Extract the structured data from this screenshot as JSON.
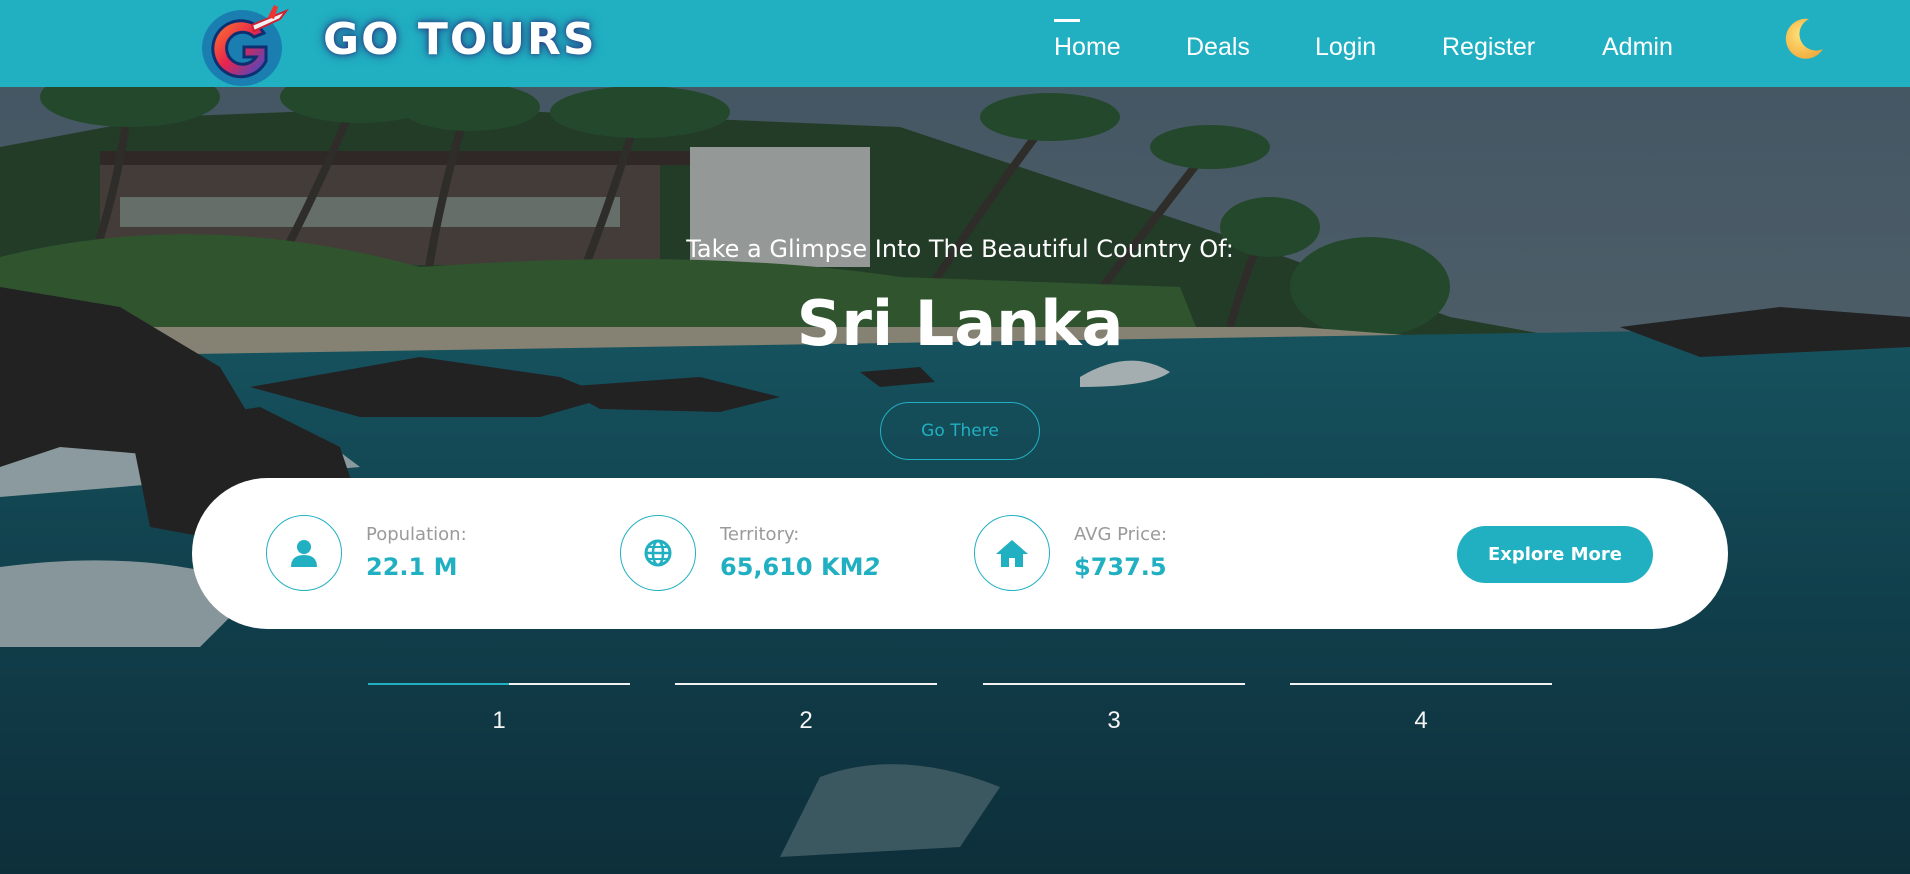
{
  "header": {
    "brand": "GO TOURS",
    "nav": [
      {
        "label": "Home",
        "active": true
      },
      {
        "label": "Deals"
      },
      {
        "label": "Login"
      },
      {
        "label": "Register"
      },
      {
        "label": "Admin"
      }
    ],
    "theme_toggle_icon": "moon-icon",
    "logo_icon": "g-airplane-logo",
    "colors": {
      "accent": "#21b0c2",
      "text_on_accent": "#ffffff"
    }
  },
  "hero": {
    "tagline": "Take a Glimpse Into The Beautiful Country Of:",
    "country": "Sri Lanka",
    "cta_label": "Go There",
    "background": "tropical beach with palm trees, house, rocks and ocean waves"
  },
  "stats": [
    {
      "icon": "user-icon",
      "label": "Population:",
      "value": "22.1 M"
    },
    {
      "icon": "globe-icon",
      "label": "Territory:",
      "value": "65,610 KM",
      "value_suffix": "2"
    },
    {
      "icon": "home-icon",
      "label": "AVG Price:",
      "value": "$737.5"
    }
  ],
  "explore_label": "Explore More",
  "slides": {
    "items": [
      "1",
      "2",
      "3",
      "4"
    ],
    "active_index": 0,
    "active_progress": 0.54
  }
}
